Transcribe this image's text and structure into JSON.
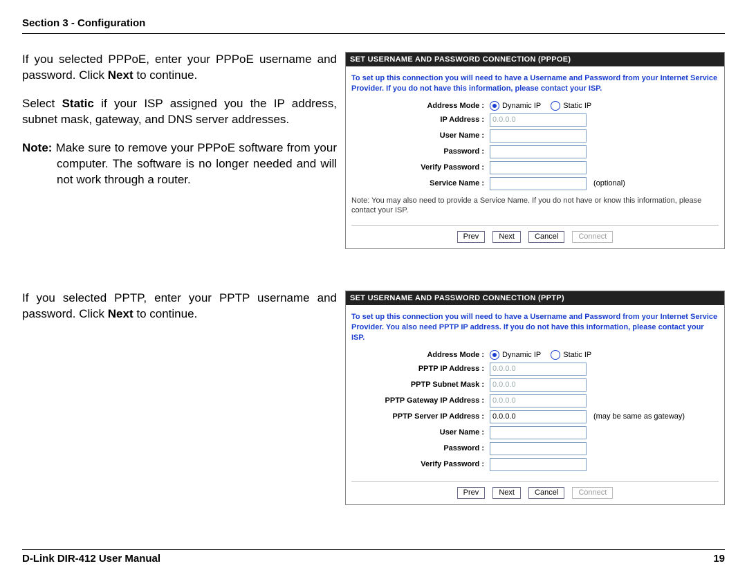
{
  "header": {
    "section": "Section 3 - Configuration"
  },
  "footer": {
    "left": "D-Link DIR-412 User Manual",
    "right": "19"
  },
  "block1": {
    "para1_pre": "If you selected PPPoE, enter your PPPoE username and password. Click ",
    "para1_bold": "Next",
    "para1_post": " to continue.",
    "para2_pre": "Select ",
    "para2_bold": "Static",
    "para2_post": " if your ISP assigned you the IP address, subnet mask, gateway, and DNS server addresses.",
    "para3_bold": "Note:",
    "para3_rest": " Make sure to remove your PPPoE software from your computer. The software is no longer needed and will not work through a router."
  },
  "panel1": {
    "title": "SET USERNAME AND PASSWORD CONNECTION (PPPOE)",
    "intro": "To set up this connection you will need to have a Username and Password from your Internet Service Provider. If you do not have this information, please contact your ISP.",
    "fields": {
      "address_mode": "Address Mode  :",
      "dyn": "Dynamic IP",
      "stat": "Static IP",
      "ip_address": "IP Address  :",
      "ip_placeholder": "0.0.0.0",
      "user_name": "User Name  :",
      "password": "Password  :",
      "verify_password": "Verify Password  :",
      "service_name": "Service Name  :",
      "optional": "(optional)"
    },
    "post_note": "Note: You may also need to provide a Service Name. If you do not have or know this information, please contact your ISP.",
    "buttons": {
      "prev": "Prev",
      "next": "Next",
      "cancel": "Cancel",
      "connect": "Connect"
    }
  },
  "block2": {
    "para1_pre": "If you selected PPTP, enter your PPTP username and password. Click ",
    "para1_bold": "Next",
    "para1_post": " to continue."
  },
  "panel2": {
    "title": "SET USERNAME AND PASSWORD CONNECTION (PPTP)",
    "intro": "To set up this connection you will need to have a Username and Password from your Internet Service Provider. You also need PPTP IP address. If you do not have this information, please contact your ISP.",
    "fields": {
      "address_mode": "Address Mode  :",
      "dyn": "Dynamic IP",
      "stat": "Static IP",
      "pptp_ip": "PPTP IP Address  :",
      "ip_placeholder": "0.0.0.0",
      "pptp_subnet": "PPTP Subnet Mask  :",
      "pptp_gateway": "PPTP Gateway IP Address  :",
      "pptp_server": "PPTP Server IP Address  :",
      "server_val": "0.0.0.0",
      "server_hint": "(may be same as gateway)",
      "user_name": "User Name  :",
      "password": "Password  :",
      "verify_password": "Verify Password  :"
    },
    "buttons": {
      "prev": "Prev",
      "next": "Next",
      "cancel": "Cancel",
      "connect": "Connect"
    }
  }
}
